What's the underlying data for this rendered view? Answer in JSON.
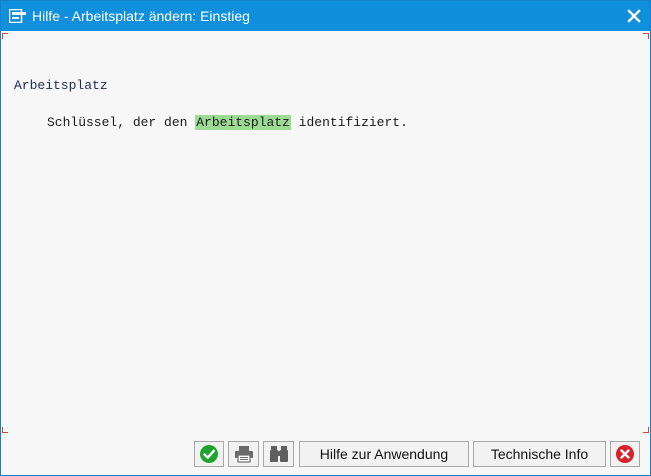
{
  "window": {
    "title": "Hilfe - Arbeitsplatz ändern: Einstieg"
  },
  "document": {
    "heading": "Arbeitsplatz",
    "text_before": "Schlüssel, der den ",
    "link_text": "Arbeitsplatz",
    "text_after": " identifiziert."
  },
  "toolbar": {
    "buttons": [
      {
        "icon": "checkmark-icon",
        "label": ""
      },
      {
        "icon": "printer-icon",
        "label": ""
      },
      {
        "icon": "binoculars-icon",
        "label": ""
      },
      {
        "icon": "",
        "label": "Hilfe zur Anwendung"
      },
      {
        "icon": "",
        "label": "Technische Info"
      },
      {
        "icon": "cancel-icon",
        "label": ""
      }
    ]
  },
  "colors": {
    "title_bar": "#0f8fdc",
    "link_highlight": "#9ddb95",
    "heading_text": "#1c2c5c",
    "confirm_green": "#1fa32e",
    "cancel_red": "#d8202a"
  }
}
